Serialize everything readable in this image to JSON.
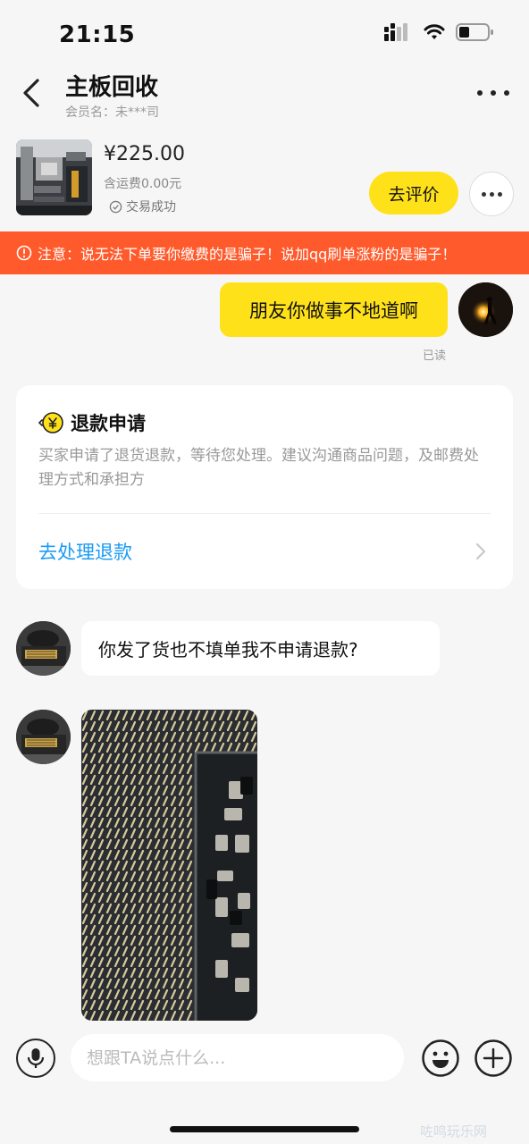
{
  "status_bar": {
    "time": "21:15",
    "icons": [
      "signal-icon",
      "wifi-icon",
      "battery-icon"
    ]
  },
  "header": {
    "title": "主板回收",
    "subtitle": "会员名：未***司",
    "back_icon": "chevron-left-icon",
    "more_icon": "more-horizontal-icon"
  },
  "product": {
    "price": "¥225.00",
    "shipping": "含运费0.00元",
    "status": "交易成功",
    "review_button": "去评价"
  },
  "warning": {
    "text": "注意：说无法下单要你缴费的是骗子！说加qq刷单涨粉的是骗子！",
    "color": "#ff5a2b"
  },
  "messages": {
    "my_message": "朋友你做事不地道啊",
    "read_status": "已读",
    "other_message": "你发了货也不填单我不申请退款?"
  },
  "refund_card": {
    "title": "退款申请",
    "description": "买家申请了退货退款，等待您处理。建议沟通商品问题，及邮费处理方式和承担方",
    "action": "去处理退款",
    "link_color": "#1a9bf5"
  },
  "input_bar": {
    "placeholder": "想跟TA说点什么...",
    "icons": [
      "microphone-icon",
      "emoji-icon",
      "plus-icon"
    ]
  },
  "watermark": "咗鸣玩乐网",
  "colors": {
    "accent": "#ffe11a",
    "background": "#f6f6f6"
  }
}
